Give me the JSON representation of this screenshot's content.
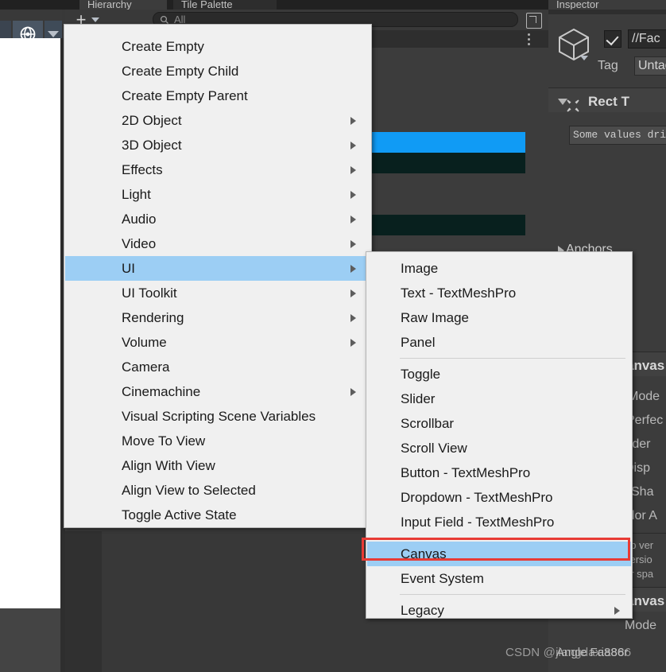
{
  "window": {
    "tabs": [
      {
        "label": "Hierarchy",
        "active": true
      },
      {
        "label": "Tile Palette",
        "active": false
      },
      {
        "label": "Inspector",
        "active": true
      }
    ]
  },
  "toolbar_left": {
    "pivot_icon": "globe-icon",
    "dropdown_icon": "chevron-down-icon",
    "left_caret_icon": "chevron-down-icon"
  },
  "hierarchy": {
    "create_button": "+",
    "create_caret_icon": "chevron-down-icon",
    "search": {
      "placeholder": "All",
      "icon": "search-icon"
    },
    "expand_icon": "expand-icon",
    "options_icon": "kebab-menu-icon",
    "overlay_icon": "gear-red-icon"
  },
  "inspector": {
    "object_icon": "cube-icon",
    "enabled_checked": true,
    "name_value": "//Fac",
    "tag_label": "Tag",
    "tag_value": "Untag",
    "rect_transform": {
      "title": "Rect T",
      "icon": "rect-transform-icon",
      "driven_notice": "Some values dri",
      "anchors_label": "Anchors",
      "anchors_icon": "chevron-right-icon"
    },
    "canvas": {
      "title": "anvas",
      "fields": [
        "Mode",
        "Perfec",
        "rder",
        "Disp",
        "l Sha",
        "olor A"
      ],
      "help_lines": [
        "ep ver",
        "versio",
        "or spa"
      ]
    },
    "canvas_scaler": {
      "title": "anvas",
      "fields": [
        "Mode"
      ]
    }
  },
  "context_menu": {
    "items": [
      {
        "label": "Create Empty",
        "submenu": false
      },
      {
        "label": "Create Empty Child",
        "submenu": false
      },
      {
        "label": "Create Empty Parent",
        "submenu": false
      },
      {
        "label": "2D Object",
        "submenu": true
      },
      {
        "label": "3D Object",
        "submenu": true
      },
      {
        "label": "Effects",
        "submenu": true
      },
      {
        "label": "Light",
        "submenu": true
      },
      {
        "label": "Audio",
        "submenu": true
      },
      {
        "label": "Video",
        "submenu": true
      },
      {
        "label": "UI",
        "submenu": true,
        "highlighted": true
      },
      {
        "label": "UI Toolkit",
        "submenu": true
      },
      {
        "label": "Rendering",
        "submenu": true
      },
      {
        "label": "Volume",
        "submenu": true
      },
      {
        "label": "Camera",
        "submenu": false
      },
      {
        "label": "Cinemachine",
        "submenu": true
      },
      {
        "label": "Visual Scripting Scene Variables",
        "submenu": false
      },
      {
        "label": "Move To View",
        "submenu": false
      },
      {
        "label": "Align With View",
        "submenu": false
      },
      {
        "label": "Align View to Selected",
        "submenu": false
      },
      {
        "label": "Toggle Active State",
        "submenu": false
      }
    ]
  },
  "ui_submenu": {
    "items": [
      {
        "label": "Image",
        "submenu": false
      },
      {
        "label": "Text - TextMeshPro",
        "submenu": false
      },
      {
        "label": "Raw Image",
        "submenu": false
      },
      {
        "label": "Panel",
        "submenu": false,
        "separator_after": true
      },
      {
        "label": "Toggle",
        "submenu": false
      },
      {
        "label": "Slider",
        "submenu": false
      },
      {
        "label": "Scrollbar",
        "submenu": false
      },
      {
        "label": "Scroll View",
        "submenu": false
      },
      {
        "label": "Button - TextMeshPro",
        "submenu": false
      },
      {
        "label": "Dropdown - TextMeshPro",
        "submenu": false
      },
      {
        "label": "Input Field - TextMeshPro",
        "submenu": false,
        "separator_after": true
      },
      {
        "label": "Canvas",
        "submenu": false,
        "highlighted": true,
        "annotated": true
      },
      {
        "label": "Event System",
        "submenu": false,
        "separator_after": true
      },
      {
        "label": "Legacy",
        "submenu": true
      }
    ]
  },
  "annotation": {
    "highlight_color": "#e83b35",
    "target": "Canvas"
  },
  "watermark": {
    "text": "CSDN @jiangdaxia886",
    "overlay_text": "Angle Fa886r"
  },
  "colors": {
    "menu_bg": "#f0f0f0",
    "menu_highlight": "#9ccef4",
    "editor_bg": "#383838",
    "panel_bg": "#3c3c3c",
    "selection_blue": "#109bf5",
    "annotation_red": "#e83b35"
  }
}
